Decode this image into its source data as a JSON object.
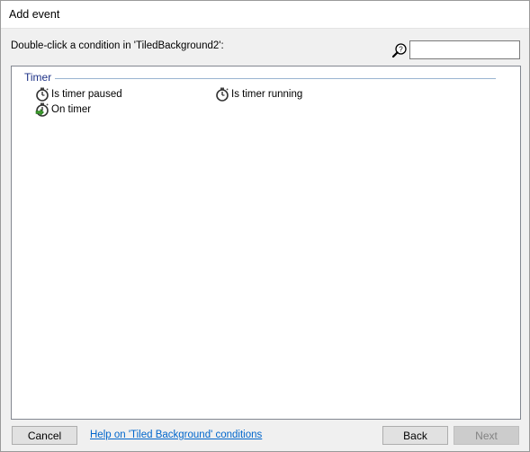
{
  "window": {
    "title": "Add event"
  },
  "prompt": "Double-click a condition in 'TiledBackground2':",
  "search": {
    "value": "",
    "placeholder": ""
  },
  "groups": [
    {
      "label": "Timer",
      "items": [
        {
          "label": "Is timer paused",
          "icon": "stopwatch-icon"
        },
        {
          "label": "Is timer running",
          "icon": "stopwatch-icon"
        },
        {
          "label": "On timer",
          "icon": "stopwatch-trigger-icon"
        }
      ]
    }
  ],
  "footer": {
    "cancel_label": "Cancel",
    "help_link": "Help on 'Tiled Background' conditions",
    "back_label": "Back",
    "next_label": "Next"
  },
  "colors": {
    "group_label": "#1e3287",
    "group_line": "#99b4d1",
    "link": "#0066cc",
    "trigger_arrow": "#3a9a2a"
  }
}
